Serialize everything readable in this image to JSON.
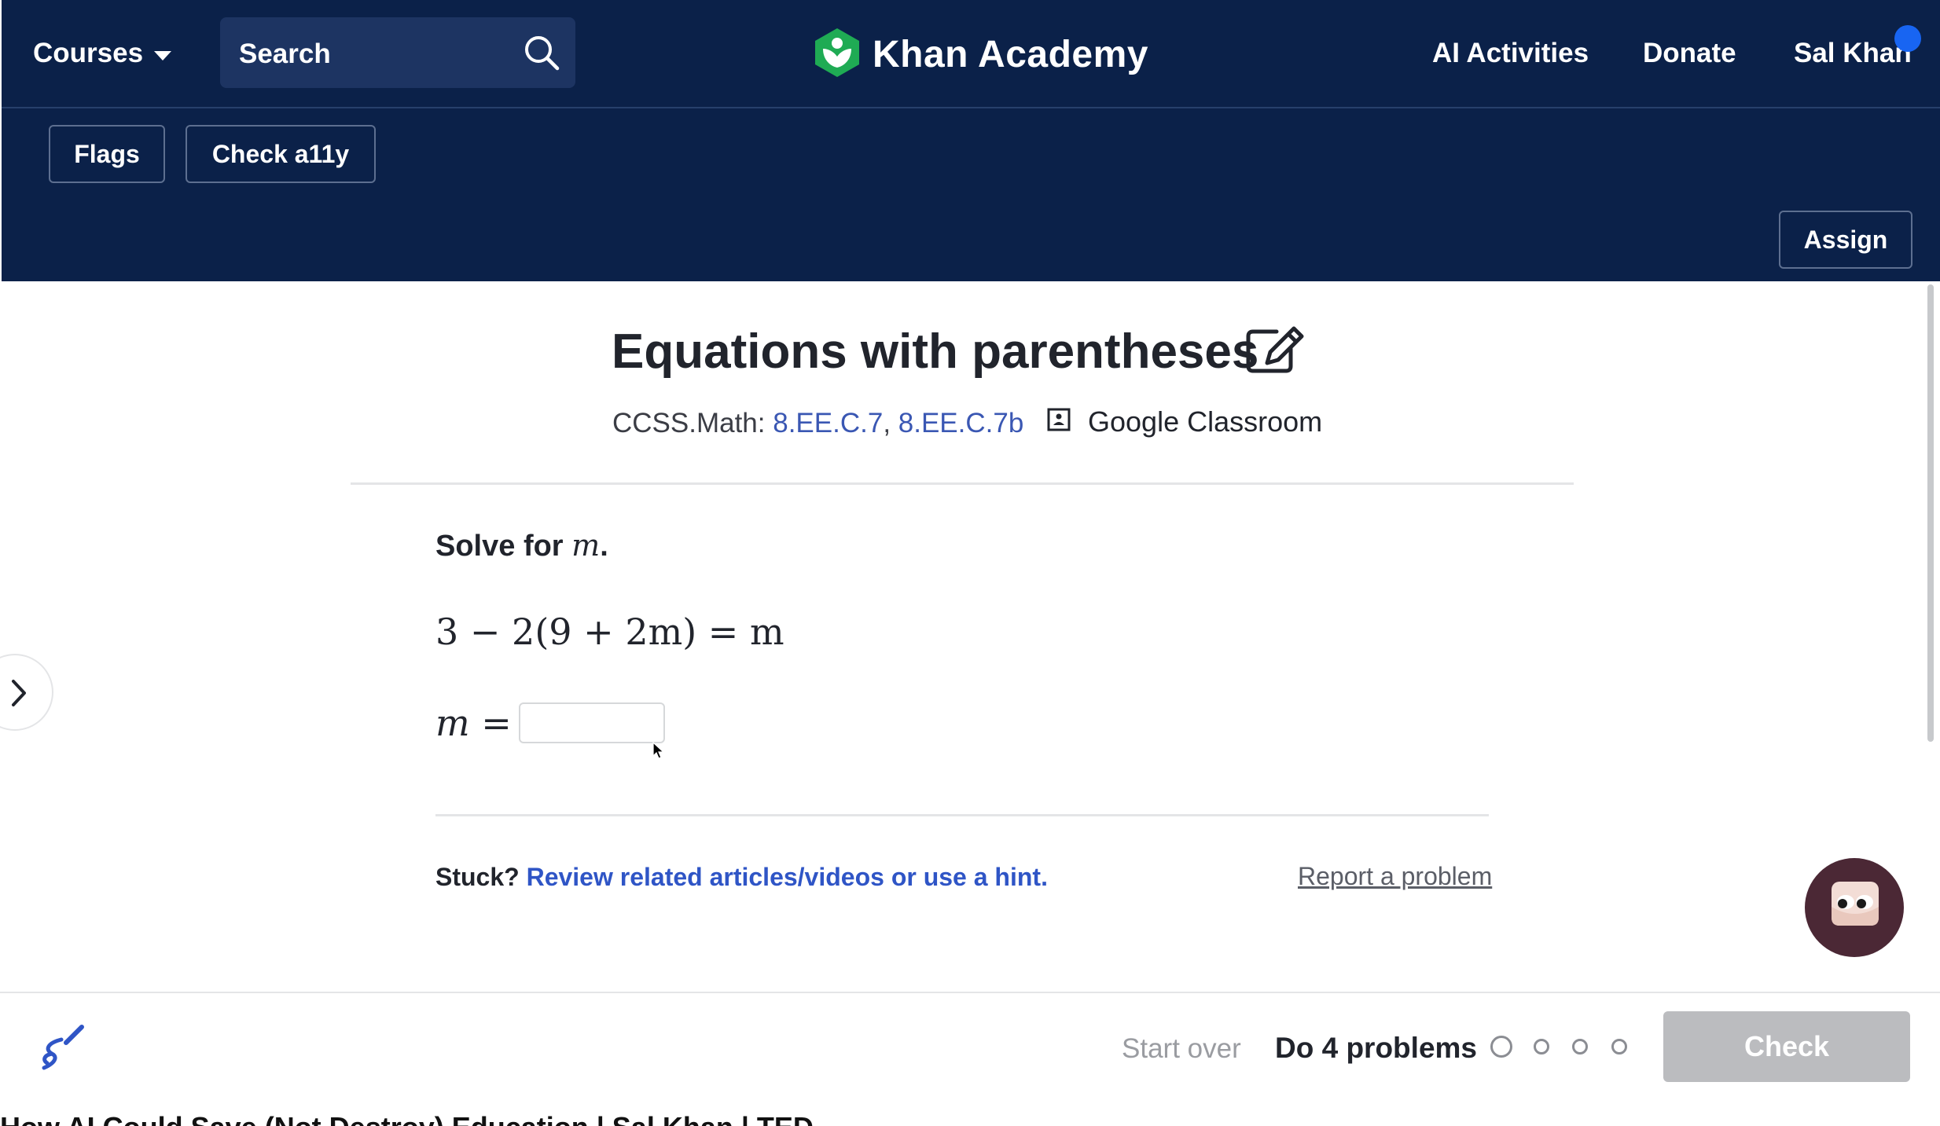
{
  "nav": {
    "courses_label": "Courses",
    "search_placeholder": "Search",
    "logo_text": "Khan Academy",
    "ai_activities": "AI Activities",
    "donate": "Donate",
    "user_name": "Sal Khan"
  },
  "toolbar": {
    "flags_label": "Flags",
    "a11y_label": "Check a11y",
    "assign_label": "Assign"
  },
  "exercise": {
    "title": "Equations with parentheses",
    "standards_prefix": "CCSS.Math: ",
    "standard_1": "8.EE.C.7",
    "standard_sep": ", ",
    "standard_2": "8.EE.C.7b",
    "classroom_label": "Google Classroom",
    "prompt_text": "Solve for ",
    "prompt_var": "m",
    "prompt_end": ".",
    "equation": "3 − 2(9 + 2m) = m",
    "answer_label": "m =",
    "answer_value": "",
    "stuck_label": "Stuck? ",
    "hint_link": "Review related articles/videos or use a hint.",
    "report_link": "Report a problem"
  },
  "footer": {
    "start_over": "Start over",
    "do_problems": "Do 4 problems",
    "check_label": "Check",
    "progress_total": 4,
    "progress_done": 0
  },
  "caption": "How AI Could Save (Not Destroy) Education | Sal Khan | TED",
  "colors": {
    "nav_bg": "#0b2149",
    "link_blue": "#2f55c6",
    "check_disabled": "#bbbcbf",
    "logo_green": "#1fab54"
  },
  "icons": [
    "chevron-down-icon",
    "search-icon",
    "khan-logo-icon",
    "edit-icon",
    "classroom-icon",
    "chevron-right-icon",
    "scratchpad-icon",
    "ai-tutor-avatar"
  ]
}
